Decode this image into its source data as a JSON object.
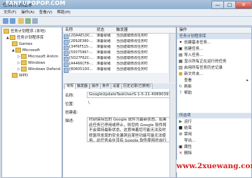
{
  "window": {
    "title": "任务计划程序",
    "watermark": "FANFUPOPOP.COM",
    "min": "—",
    "max": "□",
    "close": "✕"
  },
  "menu": [
    "文件(F)",
    "操作(A)",
    "查看(V)",
    "帮助(H)"
  ],
  "tree": [
    {
      "label": "任务计划程序 (本地)",
      "indent": 0
    },
    {
      "label": "任务计划程序库",
      "indent": 1
    },
    {
      "label": "Games",
      "indent": 2
    },
    {
      "label": "Microsoft",
      "indent": 2
    },
    {
      "label": "Microsoft Antim",
      "indent": 3
    },
    {
      "label": "Windows",
      "indent": 3
    },
    {
      "label": "Windows Defend",
      "indent": 3
    },
    {
      "label": "WPD",
      "indent": 2
    }
  ],
  "list": {
    "headers": [
      "名称",
      "状态",
      "触发器"
    ],
    "rows": [
      {
        "name": "{2DAAE1DC...",
        "status": "准备就绪",
        "trigger": "当创建或修改任务时"
      },
      {
        "name": "{2E92E380-...",
        "status": "准备就绪",
        "trigger": "当创建或修改任务时"
      },
      {
        "name": "{34F6F515-...",
        "status": "准备就绪",
        "trigger": "当创建或修改任务时"
      },
      {
        "name": "{5507596?-...",
        "status": "准备就绪",
        "trigger": "当创建或修改任务时"
      },
      {
        "name": "{5D27F62C-...",
        "status": "准备就绪",
        "trigger": "当创建或修改任务时"
      },
      {
        "name": "{A4466CF8-...",
        "status": "准备就绪",
        "trigger": "当创建或修改任务时"
      },
      {
        "name": "{B06051D0...",
        "status": "准备就绪",
        "trigger": "当创建或修改任务时"
      }
    ]
  },
  "tabs": [
    "常规",
    "触发器",
    "操作",
    "条件",
    "设置",
    "历史记录(已禁用)"
  ],
  "detail": {
    "name_label": "名称:",
    "name_value": "GoogleUpdateTaskUserS-1-5-21-408903938",
    "location_label": "位置:",
    "location_value": "\\",
    "author_label": "创建者:",
    "author_value": "",
    "desc_label": "描述:",
    "desc_value": "时刻保持您的 Google 软件为最新状态。如果此任务已停用或停止，则您的 Google 软件将不会保持最新状态，这意味着您可能无法及时修复所发现的安全漏洞且某些功能可能无法使用。此任务会在没有 Google 软件使用时自行卸载。"
  },
  "actions": {
    "header": "操作",
    "section1": "任务计划程序库",
    "items1": [
      "创建基本任务...",
      "创建任务...",
      "导入任务...",
      "显示所有正在运行的任务",
      "启用所有任务历史记录",
      "新文件夹...",
      "查看",
      "刷新",
      "帮助"
    ],
    "section2": "所选项",
    "items2": [
      "运行",
      "结束",
      "禁用",
      "导出...",
      "属性",
      "删除"
    ]
  },
  "site_watermark": "www.2xuewang.com"
}
